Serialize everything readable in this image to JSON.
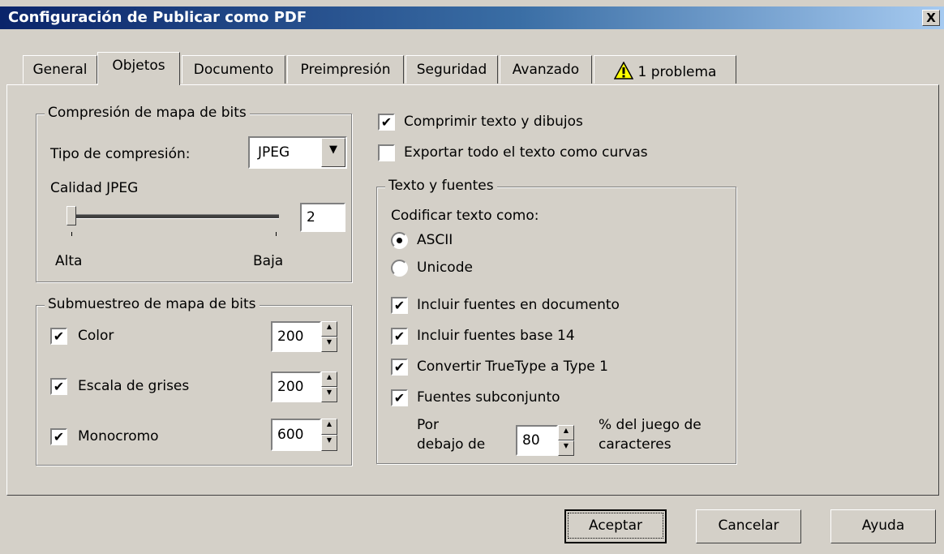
{
  "window": {
    "title": "Configuración de Publicar como PDF",
    "close_label": "X"
  },
  "tabs": [
    "General",
    "Objetos",
    "Documento",
    "Preimpresión",
    "Seguridad",
    "Avanzado",
    "1 problema"
  ],
  "active_tab": "Objetos",
  "compression": {
    "group_label": "Compresión de mapa de bits",
    "type_label": "Tipo de compresión:",
    "type_value": "JPEG",
    "quality_label": "Calidad JPEG",
    "quality_value": "2",
    "slider_min_label": "Alta",
    "slider_max_label": "Baja"
  },
  "downsample": {
    "group_label": "Submuestreo de mapa de bits",
    "items": [
      {
        "label": "Color",
        "checked": true,
        "value": "200"
      },
      {
        "label": "Escala de grises",
        "checked": true,
        "value": "200"
      },
      {
        "label": "Monocromo",
        "checked": true,
        "value": "600"
      }
    ]
  },
  "options": {
    "compress_text": {
      "label": "Comprimir texto y dibujos",
      "checked": true
    },
    "export_curves": {
      "label": "Exportar todo el texto como curvas",
      "checked": false
    }
  },
  "fonts": {
    "group_label": "Texto y fuentes",
    "encode_label": "Codificar texto como:",
    "radio_ascii": "ASCII",
    "radio_unicode": "Unicode",
    "selected_encoding": "ASCII",
    "include_fonts": {
      "label": "Incluir fuentes en documento",
      "checked": true
    },
    "base14": {
      "label": "Incluir fuentes base 14",
      "checked": true
    },
    "truetype": {
      "label": "Convertir TrueType a Type 1",
      "checked": true
    },
    "subset": {
      "label": "Fuentes subconjunto",
      "checked": true
    },
    "below_line1": "Por",
    "below_line2": "debajo de",
    "subset_value": "80",
    "percent_line1": "% del juego de",
    "percent_line2": "caracteres"
  },
  "buttons": {
    "ok": "Aceptar",
    "cancel": "Cancelar",
    "help": "Ayuda"
  },
  "icons": {
    "close": "close-icon",
    "warning": "warning-icon",
    "dropdown": "chevron-down-icon",
    "check": "checkmark-icon"
  }
}
